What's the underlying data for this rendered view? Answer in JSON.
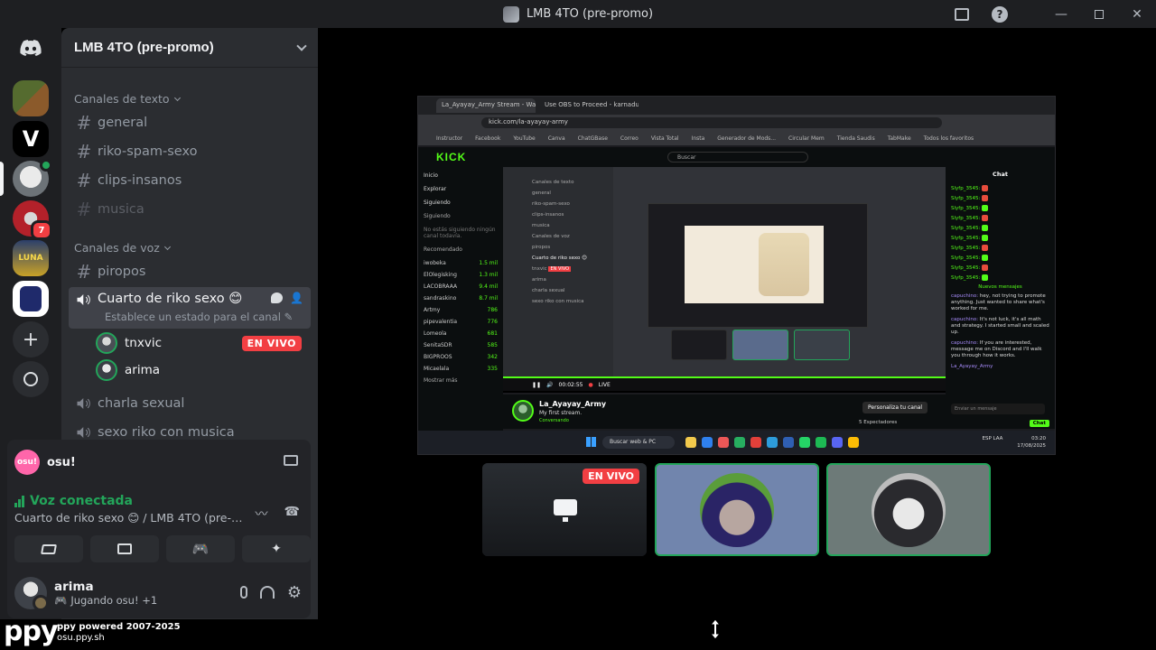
{
  "window": {
    "title": "LMB 4TO (pre-promo)"
  },
  "server": {
    "name": "LMB 4TO (pre-promo)"
  },
  "rail": {
    "items": [
      {
        "icon": "discord-home-icon"
      },
      {
        "icon": "server-icon-collage"
      },
      {
        "icon": "server-icon-v"
      },
      {
        "icon": "server-icon-active"
      },
      {
        "icon": "server-icon-red",
        "badge": "7"
      },
      {
        "icon": "server-icon-lunar"
      },
      {
        "icon": "server-icon-character"
      },
      {
        "icon": "add-server-icon"
      },
      {
        "icon": "explore-icon"
      }
    ]
  },
  "categories": {
    "text": "Canales de texto",
    "voice": "Canales de voz"
  },
  "text_channels": [
    "general",
    "riko-spam-sexo",
    "clips-insanos",
    "musica"
  ],
  "voice_channels": {
    "piropos": "piropos",
    "active": {
      "name": "Cuarto de riko sexo 😊",
      "status": "Establece un estado para el canal"
    },
    "users": [
      {
        "name": "tnxvic",
        "live": "EN VIVO"
      },
      {
        "name": "arima"
      }
    ],
    "others": [
      "charla sexual",
      "sexo riko con musica"
    ]
  },
  "activity": {
    "logo": "osu!",
    "name": "osu!"
  },
  "voice_status": {
    "title": "Voz conectada",
    "subtitle": "Cuarto de riko sexo 😊 / LMB 4TO (pre-pr..."
  },
  "user": {
    "name": "arima",
    "activity": "Jugando osu! +1"
  },
  "footer": {
    "logo": "ppy",
    "line1": "ppy powered 2007-2025",
    "line2": "osu.ppy.sh"
  },
  "stream": {
    "tabs": [
      "La_Ayayay_Army Stream - Watc",
      "Use OBS to Proceed - karnadu"
    ],
    "url": "kick.com/la-ayayay-army",
    "bookmarks": [
      "Instructor",
      "Facebook",
      "YouTube",
      "Canva",
      "ChatGBase",
      "Correo",
      "Vista Total",
      "Insta",
      "Generador de Mods...",
      "Circular Mem",
      "Tienda Saudis",
      "TabMake",
      "Todos los favoritos"
    ],
    "kick_logo": "KICK",
    "search": "Buscar",
    "nav": [
      "Inicio",
      "Explorar",
      "Siguiendo"
    ],
    "nav_following": "Siguiendo",
    "nav_empty": "No estás siguiendo ningún canal todavía.",
    "nav_recommended": "Recomendado",
    "recommended": [
      {
        "name": "iwobeka",
        "viewers": "1.5 mil"
      },
      {
        "name": "ElOlegisking",
        "viewers": "1.3 mil"
      },
      {
        "name": "LACOBRAAA",
        "viewers": "9.4 mil"
      },
      {
        "name": "sandraskino",
        "viewers": "8.7 mil"
      },
      {
        "name": "Artmy",
        "viewers": "786"
      },
      {
        "name": "pipevalentia",
        "viewers": "776"
      },
      {
        "name": "Lomeola",
        "viewers": "681"
      },
      {
        "name": "SenitaSDR",
        "viewers": "585"
      },
      {
        "name": "BIGPROOS",
        "viewers": "342"
      },
      {
        "name": "Micaelala",
        "viewers": "335"
      }
    ],
    "nav_more": "Mostrar más",
    "inner_sidebar": [
      "Canales de texto",
      "general",
      "riko-spam-sexo",
      "clips-insanos",
      "musica",
      "Canales de voz",
      "piropos",
      "Cuarto de riko sexo 😊",
      "tnxvic",
      "arima",
      "charla sexual",
      "sexo riko con musica"
    ],
    "inner_live": "EN VIVO",
    "player_time": "00:02:55",
    "player_live": "LIVE",
    "channel_name": "La_Ayayay_Army",
    "channel_desc": "My first stream.",
    "channel_tag": "Conversando",
    "customize": "Personaliza tu canal",
    "viewers": "5 Espectadores",
    "chat_title": "Chat",
    "chat_lines": [
      "Slyfp_3545:",
      "Slyfp_3545:",
      "Slyfp_3545:",
      "Slyfp_3545:",
      "Slyfp_3545:",
      "Slyfp_3545:",
      "Slyfp_3545:",
      "Slyfp_3545:",
      "Slyfp_3545:",
      "Slyfp_3545:"
    ],
    "chat_new": "Nuevos mensajes",
    "chat_msgs": [
      {
        "user": "capuchino:",
        "text": "hey, not trying to promote anything. Just wanted to share what's worked for me."
      },
      {
        "user": "capuchino:",
        "text": "It's not luck, it's all math and strategy. I started small and scaled up."
      },
      {
        "user": "capuchino:",
        "text": "If you are interested, message me on Discord and I'll walk you through how it works."
      }
    ],
    "chat_user_self": "La_Ayayay_Army",
    "chat_input": "Enviar un mensaje",
    "chat_send": "Chat",
    "taskbar_search": "Buscar web & PC",
    "clock_lang": "ESP LAA",
    "clock_time": "03:20",
    "clock_date": "17/08/2025"
  },
  "thumbs": {
    "live": "EN VIVO"
  }
}
